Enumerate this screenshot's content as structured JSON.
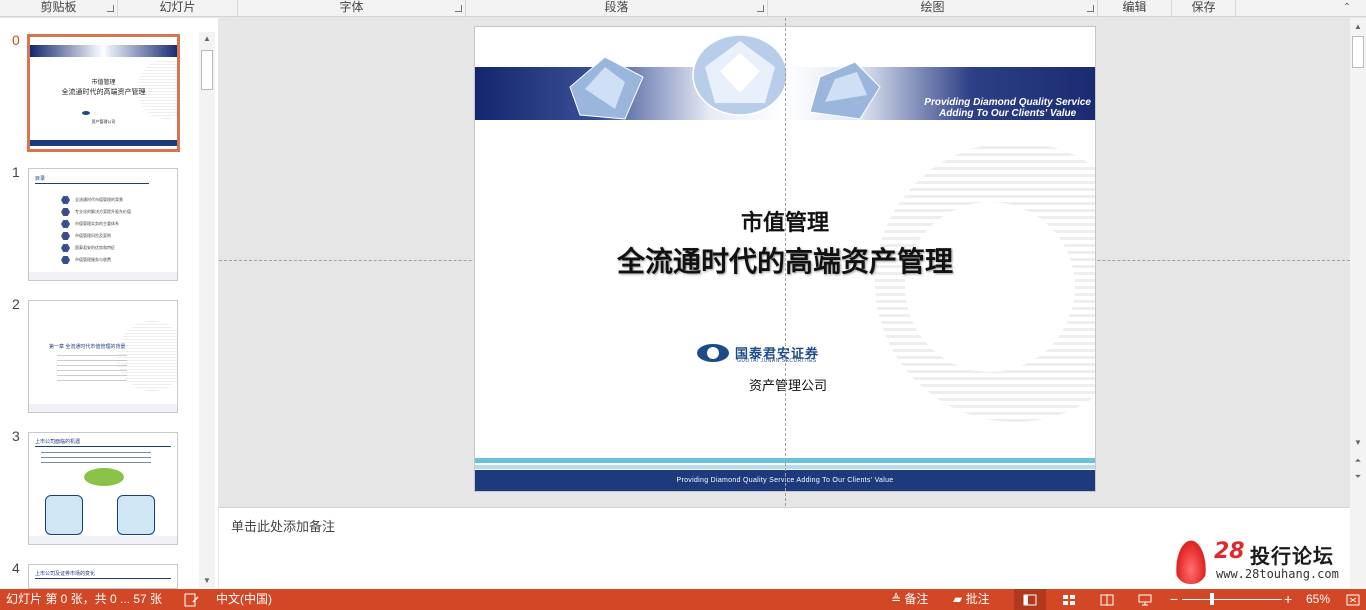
{
  "ribbon": {
    "groups": [
      {
        "label": "剪贴板",
        "has_launcher": true
      },
      {
        "label": "幻灯片",
        "has_launcher": false
      },
      {
        "label": "字体",
        "has_launcher": true
      },
      {
        "label": "段落",
        "has_launcher": true
      },
      {
        "label": "绘图",
        "has_launcher": true
      },
      {
        "label": "编辑",
        "has_launcher": false
      },
      {
        "label": "保存",
        "has_launcher": false
      }
    ]
  },
  "thumbnails": [
    {
      "number": "0",
      "active": true,
      "title": "市值管理",
      "subtitle": "全流通时代的高端资产管理",
      "company": "资产管理公司"
    },
    {
      "number": "1",
      "active": false,
      "heading": "目录",
      "rows": [
        "全流通时代市值管理的背景",
        "专业化的解决方案提升股东价值",
        "市值管理实务的主要体系",
        "市值管理风险及案例",
        "国泰君安的优势和特征",
        "市值管理服务与收费"
      ]
    },
    {
      "number": "2",
      "active": false,
      "heading": "第一章 全流通时代市值管理的背景"
    },
    {
      "number": "3",
      "active": false,
      "heading": "上市公司面临的机遇"
    },
    {
      "number": "4",
      "active": false,
      "heading": "上市公司及证券市场的变化"
    }
  ],
  "slide": {
    "banner_line1": "Providing Diamond Quality Service",
    "banner_line2": "Adding To Our Clients' Value",
    "title": "市值管理",
    "subtitle": "全流通时代的高端资产管理",
    "logo_cn": "国泰君安证券",
    "logo_en": "GUOTAI JUNAN SECURITIES",
    "company": "资产管理公司",
    "footer": "Providing Diamond Quality Service    Adding To Our Clients' Value"
  },
  "notes": {
    "placeholder": "单击此处添加备注"
  },
  "statusbar": {
    "slide_info": "幻灯片 第 0 张，共 0 ... 57 张",
    "language": "中文(中国)",
    "notes_label": "备注",
    "comments_label": "批注",
    "zoom": "65%",
    "accent": "#d24726"
  },
  "watermark": {
    "number": "28",
    "name": "投行论坛",
    "url": "www.28touhang.com"
  }
}
